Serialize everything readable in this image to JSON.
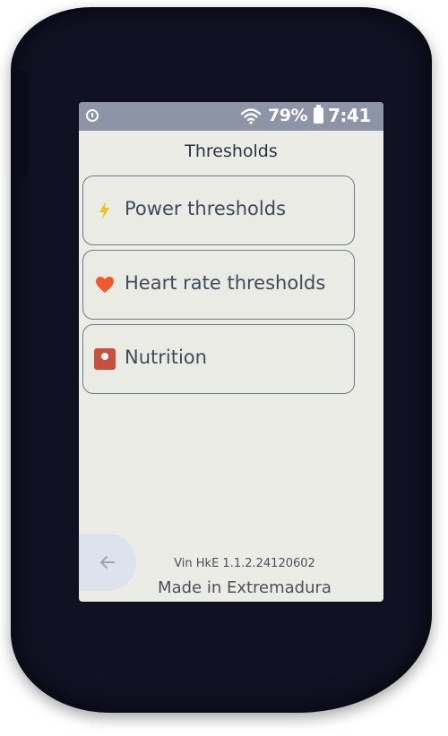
{
  "status_bar": {
    "left_icon": "info-circle-icon",
    "wifi_icon": "wifi-icon",
    "battery_percent": "79%",
    "battery_icon": "battery-icon",
    "time": "7:41"
  },
  "header": {
    "title": "Thresholds"
  },
  "menu": {
    "items": [
      {
        "label": "Power thresholds",
        "icon": "lightning-bolt-icon",
        "icon_color": "#f0c020"
      },
      {
        "label": "Heart rate thresholds",
        "icon": "heart-icon",
        "icon_color": "#f05a28"
      },
      {
        "label": "Nutrition",
        "icon": "nutrition-icon",
        "icon_color": "#c8503c"
      }
    ]
  },
  "footer": {
    "back_icon": "arrow-left-icon",
    "version": "Vin HkE 1.1.2.24120602",
    "made_in": "Made in Extremadura"
  },
  "colors": {
    "screen_background": "#ecece6",
    "status_bar_background": "#8c94a6",
    "device_body": "#101224",
    "text_primary": "#3f4a5c"
  }
}
